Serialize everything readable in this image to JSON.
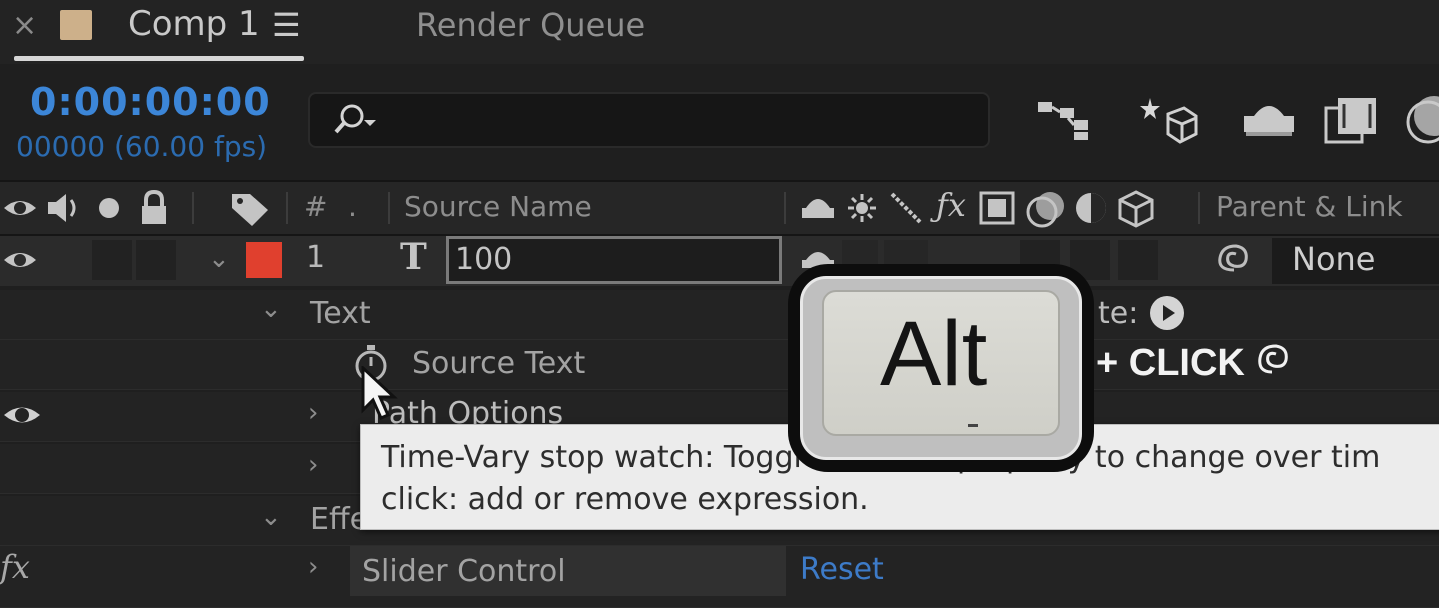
{
  "tabs": {
    "close": "×",
    "comp_label": "Comp 1",
    "menu": "☰",
    "render_queue": "Render Queue"
  },
  "time": {
    "timecode": "0:00:00:00",
    "frames": "00000 (60.00 fps)"
  },
  "search": {
    "placeholder": "",
    "value": ""
  },
  "header": {
    "hash": "#",
    "dot": ".",
    "source_name": "Source Name",
    "parent_link": "Parent & Link"
  },
  "layer": {
    "number": "1",
    "type_glyph": "T",
    "name": "100",
    "parent": "None"
  },
  "properties": {
    "text_group": "Text",
    "source_text": "Source Text",
    "path_options": "Path Options",
    "effects_group": "Effects",
    "fx_badge": "fx",
    "slider_control": "Slider Control",
    "reset": "Reset",
    "rate_partial": "te:"
  },
  "tooltip": {
    "line1": "Time-Vary stop watch: Toggle to allow property to change over tim",
    "line2": "click: add or remove expression."
  },
  "overlay": {
    "key": "Alt",
    "plus_click": "+ CLICK"
  },
  "colors": {
    "timecode": "#3c86d8",
    "label": "#e0402e",
    "comp_swatch": "#cdb08a",
    "link": "#3d7bc8"
  }
}
